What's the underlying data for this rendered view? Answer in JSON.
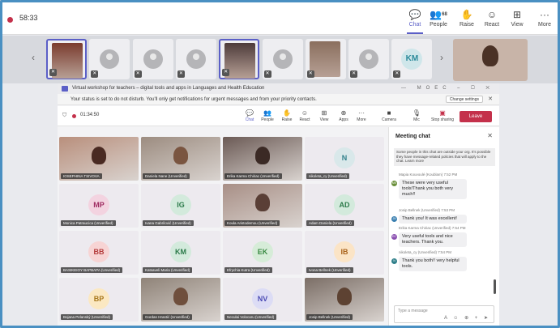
{
  "window": {
    "timer": "58:33",
    "buttons": [
      {
        "label": "Chat",
        "icon": "chat-icon",
        "glyph": "💬"
      },
      {
        "label": "People",
        "icon": "people-icon",
        "glyph": "👥",
        "badge": "68"
      },
      {
        "label": "Raise",
        "icon": "hand-icon",
        "glyph": "✋"
      },
      {
        "label": "React",
        "icon": "smile-icon",
        "glyph": "☺"
      },
      {
        "label": "View",
        "icon": "grid-icon",
        "glyph": "⊞"
      },
      {
        "label": "More",
        "icon": "ellipsis-icon",
        "glyph": "···"
      }
    ]
  },
  "strip": {
    "participants": [
      {
        "type": "video",
        "color": "#7a3b2e"
      },
      {
        "type": "avatar"
      },
      {
        "type": "avatar"
      },
      {
        "type": "avatar"
      },
      {
        "type": "video",
        "color": "#4d3b3b"
      },
      {
        "type": "avatar"
      },
      {
        "type": "video",
        "color": "#8a6f5e"
      },
      {
        "type": "avatar"
      },
      {
        "type": "initials",
        "initials": "KM"
      }
    ]
  },
  "inner": {
    "title": "Virtual workshop for teachers – digital tools and apps in Languages and Health Education",
    "title_right": "— MOEC",
    "notice": "Your status is set to do not disturb. You'll only get notifications for urgent messages and from your priority contacts.",
    "change_settings": "Change settings",
    "timer": "01:34:50",
    "toolbar": [
      {
        "label": "Chat",
        "glyph": "💬"
      },
      {
        "label": "People",
        "glyph": "👥"
      },
      {
        "label": "Raise",
        "glyph": "✋"
      },
      {
        "label": "React",
        "glyph": "☺"
      },
      {
        "label": "View",
        "glyph": "⊞"
      },
      {
        "label": "Apps",
        "glyph": "⊕"
      },
      {
        "label": "More",
        "glyph": "···"
      },
      {
        "label": "Camera",
        "glyph": "■"
      },
      {
        "label": "Mic",
        "glyph": "🎙"
      },
      {
        "label": "Stop sharing",
        "glyph": "▣"
      }
    ],
    "leave": "Leave"
  },
  "gallery": [
    {
      "name": "IOSEPHINA TSIVOVA",
      "kind": "photo",
      "bg": "#b98f7c",
      "head": "#4a2a22"
    },
    {
      "name": "Daniela Nane (Unverified)",
      "kind": "photo",
      "bg": "#9c8c80",
      "head": "#7a5540"
    },
    {
      "name": "Erika Karma Chiriac (Unverified)",
      "kind": "photo",
      "bg": "#6b5a55",
      "head": "#3b2a25"
    },
    {
      "name": "nikoleta_cy (Unverified)",
      "kind": "initials",
      "initials": "N",
      "bg": "#d9e8ea",
      "fg": "#2f7f8a"
    },
    {
      "name": "Monica Patraucica (Unverified)",
      "kind": "initials",
      "initials": "MP",
      "bg": "#f3d3e0",
      "fg": "#a02e63"
    },
    {
      "name": "Ivana Gabrilović (Unverified)",
      "kind": "initials",
      "initials": "IG",
      "bg": "#d3eadc",
      "fg": "#2b7a49"
    },
    {
      "name": "Koula Aristodemou (Unverified)",
      "kind": "photo",
      "bg": "#a88f86",
      "head": "#5a3f36"
    },
    {
      "name": "Adam Daniela (Unverified)",
      "kind": "initials",
      "initials": "AD",
      "bg": "#d3eadc",
      "fg": "#2b7a49"
    },
    {
      "name": "BASIKEIOY BAPBAPA (Unverified)",
      "kind": "initials",
      "initials": "BB",
      "bg": "#f7d4d4",
      "fg": "#b33a3a"
    },
    {
      "name": "Katsaveli Maria (Unverified)",
      "kind": "initials",
      "initials": "KM",
      "bg": "#d3eadc",
      "fg": "#2b7a49"
    },
    {
      "name": "Efrychia Kutra (Unverified)",
      "kind": "initials",
      "initials": "EK",
      "bg": "#d6ecd8",
      "fg": "#3b8a44"
    },
    {
      "name": "Ivona Bellnek (Unverified)",
      "kind": "initials",
      "initials": "IB",
      "bg": "#fbe4c6",
      "fg": "#a8621a"
    },
    {
      "name": "Bojana Pelanský (Unverified)",
      "kind": "initials",
      "initials": "BP",
      "bg": "#fbe8c2",
      "fg": "#a8771a"
    },
    {
      "name": "Gordan Hrastić (Unverified)",
      "kind": "photo",
      "bg": "#8f8378",
      "head": "#6f4f3d"
    },
    {
      "name": "Neculai Volocaru (Unverified)",
      "kind": "initials",
      "initials": "NV",
      "bg": "#dcdcf5",
      "fg": "#4b4bb5"
    },
    {
      "name": "Josip Bellnek (Unverified)",
      "kind": "photo",
      "bg": "#7b6e66",
      "head": "#5d4232"
    }
  ],
  "chat": {
    "title": "Meeting chat",
    "warning": "Some people in this chat are outside your org. It's possible they have message-related policies that will apply to the chat. Learn more",
    "messages": [
      {
        "meta": "Mapia Kouvoulé (Koublam)  7:52 PM",
        "text": "These were very useful tools!Thank you both very much!!",
        "initials": "MK",
        "color": "#6a8f3a"
      },
      {
        "meta": "Josip Bellnek (Unverified)  7:53 PM",
        "text": "Thank you! It was excellent!",
        "initials": "JB",
        "color": "#3a7fb0"
      },
      {
        "meta": "Erika Karma Chiriac (Unverified)  7:54 PM",
        "text": "Very useful tools and nice teachers. Thank you.",
        "initials": "EC",
        "color": "#8a4fb0"
      },
      {
        "meta": "nikoleta_cy (Unverified)  7:54 PM",
        "text": "Thank you both!! very helpful tools.",
        "initials": "N",
        "color": "#2f7f8a"
      }
    ],
    "compose_placeholder": "Type a message"
  },
  "colors": {
    "accent": "#5b5fc7",
    "leave": "#c4314b",
    "frame": "#4a90c2"
  }
}
